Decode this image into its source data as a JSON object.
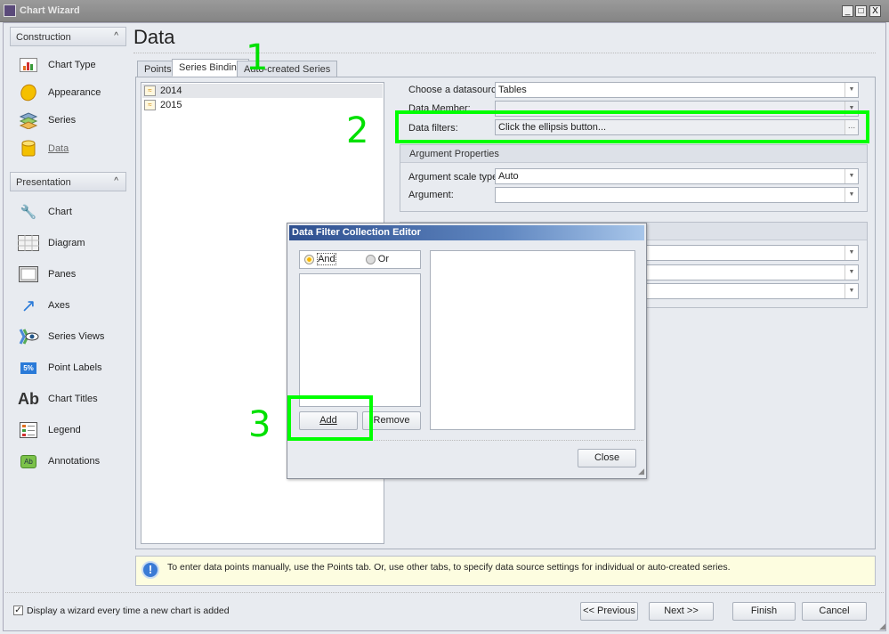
{
  "window": {
    "title": "Chart Wizard",
    "controls": [
      "_",
      "□",
      "X"
    ]
  },
  "sidebar": {
    "construction": {
      "label": "Construction",
      "items": [
        {
          "label": "Chart Type",
          "icon": "chart-type-icon"
        },
        {
          "label": "Appearance",
          "icon": "palette-icon"
        },
        {
          "label": "Series",
          "icon": "series-icon"
        },
        {
          "label": "Data",
          "icon": "database-icon",
          "active": true
        }
      ]
    },
    "presentation": {
      "label": "Presentation",
      "items": [
        {
          "label": "Chart",
          "icon": "wrench-icon"
        },
        {
          "label": "Diagram",
          "icon": "diagram-icon"
        },
        {
          "label": "Panes",
          "icon": "panes-icon"
        },
        {
          "label": "Axes",
          "icon": "arrow-icon"
        },
        {
          "label": "Series Views",
          "icon": "eye-icon"
        },
        {
          "label": "Point Labels",
          "icon": "label-icon",
          "badge": "5%"
        },
        {
          "label": "Chart Titles",
          "icon": "text-icon",
          "badge": "Ab"
        },
        {
          "label": "Legend",
          "icon": "legend-icon"
        },
        {
          "label": "Annotations",
          "icon": "annotation-icon",
          "badge": "Ab"
        }
      ]
    }
  },
  "main": {
    "title": "Data",
    "tabs": [
      {
        "label": "Points"
      },
      {
        "label": "Series Binding",
        "active": true
      },
      {
        "label": "Auto-created Series"
      }
    ],
    "series": [
      "2014",
      "2015"
    ],
    "datasource_label": "Choose a datasource:",
    "datasource_value": "Tables",
    "data_member_label": "Data Member:",
    "data_filters_label": "Data filters:",
    "data_filters_value": "Click the ellipsis button...",
    "ellipsis": "...",
    "argument_group": "Argument Properties",
    "arg_scale_label": "Argument scale type:",
    "arg_scale_value": "Auto",
    "argument_label": "Argument:",
    "info": "To enter data points manually, use the Points tab. Or, use other tabs, to specify data source settings for individual or auto-created series."
  },
  "dialog": {
    "title": "Data Filter Collection Editor",
    "and": "And",
    "or": "Or",
    "selected": "And",
    "add": "Add",
    "remove": "Remove",
    "close": "Close"
  },
  "footer": {
    "checkbox_label": "Display a wizard every time a new chart is added",
    "checked": true,
    "previous": "<< Previous",
    "next": "Next >>",
    "finish": "Finish",
    "cancel": "Cancel"
  },
  "annotations": {
    "step1": "1",
    "step2": "2",
    "step3": "3",
    "color": "#00ff00"
  }
}
